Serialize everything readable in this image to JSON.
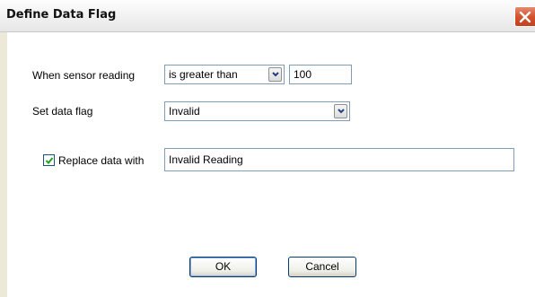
{
  "dialog": {
    "title": "Define Data Flag",
    "close_icon": "close-x-icon"
  },
  "form": {
    "sensor_label": "When sensor reading",
    "comparison": {
      "selected": "is greater than"
    },
    "threshold_value": "100",
    "flag_label": "Set data flag",
    "flag": {
      "selected": "Invalid"
    },
    "replace": {
      "checked": true,
      "label": "Replace data with",
      "value": "Invalid Reading"
    }
  },
  "buttons": {
    "ok": "OK",
    "cancel": "Cancel"
  },
  "colors": {
    "title_close_red": "#d4532f",
    "field_border": "#7f9db9",
    "button_border": "#003c74",
    "check_green": "#21a121"
  }
}
